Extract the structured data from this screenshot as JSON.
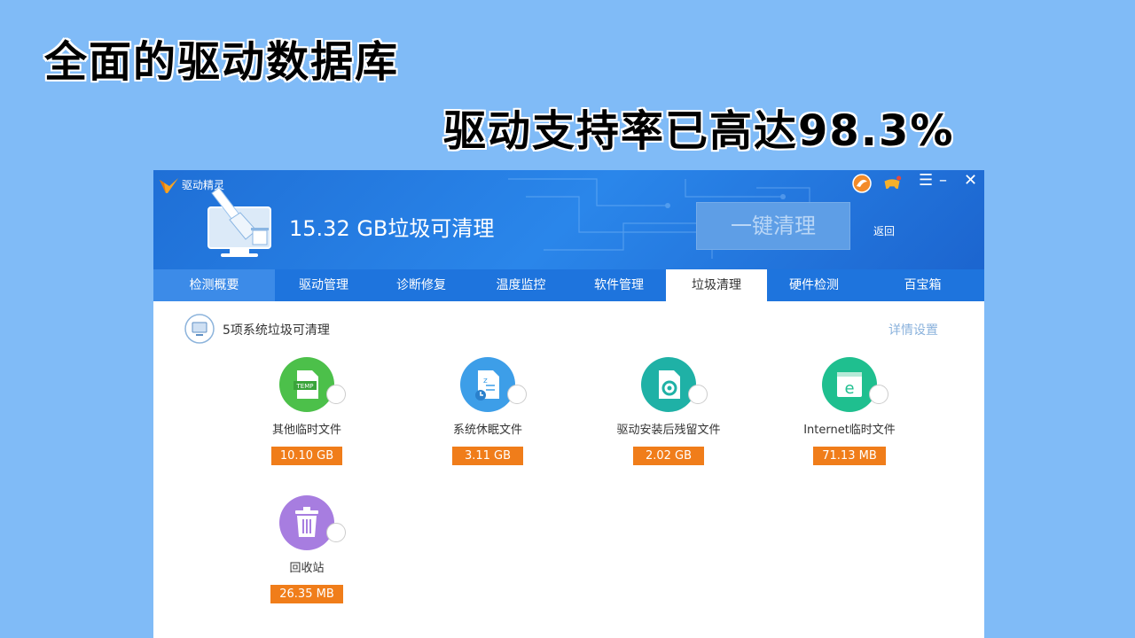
{
  "promo": {
    "line1": "全面的驱动数据库",
    "line2": "驱动支持率已高达98.3%"
  },
  "app": {
    "name": "驱动精灵",
    "headline": "15.32 GB垃圾可清理",
    "clean_button": "一键清理",
    "back": "返回",
    "controls": {
      "menu": "☰",
      "minimize": "–",
      "close": "✕"
    }
  },
  "tabs": [
    {
      "label": "检测概要"
    },
    {
      "label": "驱动管理"
    },
    {
      "label": "诊断修复"
    },
    {
      "label": "温度监控"
    },
    {
      "label": "软件管理"
    },
    {
      "label": "垃圾清理"
    },
    {
      "label": "硬件检测"
    },
    {
      "label": "百宝箱"
    }
  ],
  "active_tab": "垃圾清理",
  "section": {
    "title": "5项系统垃圾可清理",
    "detail_link": "详情设置"
  },
  "items": [
    {
      "label": "其他临时文件",
      "size": "10.10 GB",
      "icon": "temp-file-icon",
      "color": "#4cc04a"
    },
    {
      "label": "系统休眠文件",
      "size": "3.11 GB",
      "icon": "sleep-file-icon",
      "color": "#3d9ee8"
    },
    {
      "label": "驱动安装后残留文件",
      "size": "2.02 GB",
      "icon": "driver-file-icon",
      "color": "#1fb1a6"
    },
    {
      "label": "Internet临时文件",
      "size": "71.13 MB",
      "icon": "ie-file-icon",
      "color": "#1fbf8f"
    },
    {
      "label": "回收站",
      "size": "26.35 MB",
      "icon": "recycle-bin-icon",
      "color": "#a77de0"
    }
  ],
  "colors": {
    "page_bg": "#80bbf7",
    "header": "#2a86ea",
    "tabbar": "#1e74dd",
    "size_badge": "#f07d1a"
  }
}
